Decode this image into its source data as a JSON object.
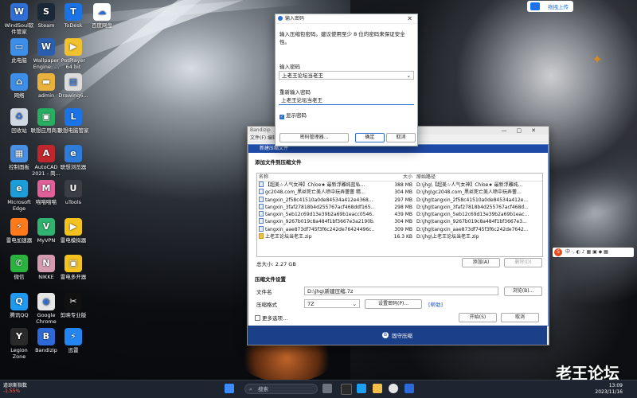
{
  "desktop_icons": [
    {
      "label": "WindSoul软件管家",
      "icon": "windsoul-icon",
      "color": "#2f6fd6",
      "glyph": "W"
    },
    {
      "label": "Steam",
      "icon": "steam-icon",
      "color": "#1b2838",
      "glyph": "S"
    },
    {
      "label": "ToDesk",
      "icon": "todesk-icon",
      "color": "#1a74e8",
      "glyph": "T"
    },
    {
      "label": "百度网盘",
      "icon": "baidu-netdisk-icon",
      "color": "#ffffff",
      "glyph": "☁"
    },
    {
      "label": "此电脑",
      "icon": "computer-icon",
      "color": "#3d8ee8",
      "glyph": "▭"
    },
    {
      "label": "Wallpaper Engine: ...",
      "icon": "wallpaper-engine-icon",
      "color": "#2a5fb0",
      "glyph": "W"
    },
    {
      "label": "PotPlayer 64 bit",
      "icon": "potplayer-icon",
      "color": "#f2c12e",
      "glyph": "▶"
    },
    {
      "label": "网络",
      "icon": "network-icon",
      "color": "#3d8ee8",
      "glyph": "⌂"
    },
    {
      "label": "admin",
      "icon": "user-folder-icon",
      "color": "#e9b23c",
      "glyph": "▬"
    },
    {
      "label": "Drawing6...",
      "icon": "drawing-file-icon",
      "color": "#dcdcdc",
      "glyph": "▤"
    },
    {
      "label": "回收站",
      "icon": "recycle-bin-icon",
      "color": "#cfd8e3",
      "glyph": "♻"
    },
    {
      "label": "联想应用商店",
      "icon": "lenovo-store-icon",
      "color": "#27ae60",
      "glyph": "▣"
    },
    {
      "label": "联想电脑管家",
      "icon": "lenovo-manager-icon",
      "color": "#1a74e8",
      "glyph": "L"
    },
    {
      "label": "控制面板",
      "icon": "control-panel-icon",
      "color": "#4a90e2",
      "glyph": "▦"
    },
    {
      "label": "AutoCAD 2021 - 简...",
      "icon": "autocad-icon",
      "color": "#c0262d",
      "glyph": "A"
    },
    {
      "label": "联想浏览器",
      "icon": "lenovo-browser-icon",
      "color": "#2e7bd9",
      "glyph": "e"
    },
    {
      "label": "Microsoft Edge",
      "icon": "edge-icon",
      "color": "#1c9dd8",
      "glyph": "e"
    },
    {
      "label": "喵喵喵喵",
      "icon": "meow-app-icon",
      "color": "#e0609a",
      "glyph": "M"
    },
    {
      "label": "uTools",
      "icon": "utools-icon",
      "color": "#3b3f45",
      "glyph": "U"
    },
    {
      "label": "雷电加速器",
      "icon": "leidian-accelerator-icon",
      "color": "#ff7a1a",
      "glyph": "⚡"
    },
    {
      "label": "MyVPN",
      "icon": "myvpn-icon",
      "color": "#2fb36e",
      "glyph": "V"
    },
    {
      "label": "雷电模拟器",
      "icon": "leidian-emulator-icon",
      "color": "#f4c21f",
      "glyph": "▶"
    },
    {
      "label": "微信",
      "icon": "wechat-icon",
      "color": "#29b33f",
      "glyph": "✆"
    },
    {
      "label": "NIKKE",
      "icon": "nikke-icon",
      "color": "#d49bb0",
      "glyph": "N"
    },
    {
      "label": "雷电多开器",
      "icon": "leidian-multi-icon",
      "color": "#f4c21f",
      "glyph": "▣"
    },
    {
      "label": "腾讯QQ",
      "icon": "qq-icon",
      "color": "#1e9bf0",
      "glyph": "Q"
    },
    {
      "label": "Google Chrome",
      "icon": "chrome-icon",
      "color": "#e6e6e6",
      "glyph": "◉"
    },
    {
      "label": "剪映专业版",
      "icon": "capcut-icon",
      "color": "#111111",
      "glyph": "✂"
    },
    {
      "label": "Legion Zone",
      "icon": "legion-zone-icon",
      "color": "#2a2a2a",
      "glyph": "Y"
    },
    {
      "label": "Bandizip",
      "icon": "bandizip-icon",
      "color": "#2d6ad8",
      "glyph": "B"
    },
    {
      "label": "迅雷",
      "icon": "thunder-icon",
      "color": "#2386f0",
      "glyph": "⚡"
    }
  ],
  "top_right": {
    "upload_label": "拖拽上传"
  },
  "bandizip": {
    "window_title": "Bandizip",
    "menu": "文件(F)  编辑",
    "dialog_title": "新建压缩文件",
    "add_section": "添加文件到压缩文件",
    "columns": {
      "name": "名称",
      "size": "大小",
      "path": "原始路径"
    },
    "files": [
      {
        "name": "【超美☆人气女神】Chloe★ 最新浮雕纯蓝私...",
        "size": "388 MB",
        "path": "D:\\jhg\\【超美☆人气女神】Chloe★ 最新浮雕纯...",
        "folder": false
      },
      {
        "name": "gc2048.com_黑丝死亡美人喷中玩弄蕾蕾 精...",
        "size": "304 MB",
        "path": "D:\\jhg\\gc2048.com_黑丝死亡美人喷中玩弄蕾...",
        "folder": false
      },
      {
        "name": "tangxin_2f58c41510a0de84534a412e4368...",
        "size": "297 MB",
        "path": "D:\\jhg\\tangxin_2f58c41510a0de84534a412e...",
        "folder": false
      },
      {
        "name": "tangxin_3faf27818b4d255767acf468ddf165...",
        "size": "298 MB",
        "path": "D:\\jhg\\tangxin_3faf27818b4d255767acf468d...",
        "folder": false
      },
      {
        "name": "tangxin_5eb12c69d13e39b2a69b1eacc0546...",
        "size": "439 MB",
        "path": "D:\\jhg\\tangxin_5eb12c69d13e39b2a69b1eac...",
        "folder": false
      },
      {
        "name": "tangxin_9267b019c8a484f1bf3667e3a2190b...",
        "size": "304 MB",
        "path": "D:\\jhg\\tangxin_9267b019c8a484f1bf3667e3...",
        "folder": false
      },
      {
        "name": "tangxin_aae873df745f3f6c242de76424496c...",
        "size": "309 MB",
        "path": "D:\\jhg\\tangxin_aae873df745f3f6c242de7642...",
        "folder": false
      },
      {
        "name": "上老王论坛当老王.zip",
        "size": "16.3 KB",
        "path": "D:\\jhg\\上老王论坛当老王.zip",
        "folder": true
      }
    ],
    "total": "总大小: 2.27 GB",
    "add_btn": "添加(A)",
    "delete_btn": "删除(D)",
    "settings_section": "压缩文件设置",
    "filename_label": "文件名",
    "filename_value": "D:\\jhg\\新建压缩.7z",
    "browse_btn": "浏览(B)...",
    "format_label": "压缩格式",
    "format_value": "7Z",
    "set_password_btn": "设置密码(P)...",
    "help_link": "[帮助]",
    "more_options": "更多选项...",
    "start_btn": "开始(S)",
    "cancel_btn": "取消",
    "footer_label": "固守压缩"
  },
  "password_dialog": {
    "title": "输入密码",
    "hint": "输入压缩包密码。建议使用至少 8 位的密码来保证安全性。",
    "password_label": "输入密码",
    "password_value": "上老王论坛当老王",
    "confirm_label": "重新输入密码",
    "confirm_value": "上老王论坛当老王",
    "show_password": "显示密码",
    "manager_btn": "密码管理器...",
    "ok_btn": "确定",
    "cancel_btn": "取消"
  },
  "ime_bar": {
    "label": "中 ·,   ◐  ♪  ▦  ▣  ◆  ▦"
  },
  "taskbar": {
    "weather_title": "道琼斯指数",
    "weather_value": "-1.55%",
    "search_placeholder": "搜索",
    "time": "13:09",
    "date": "2023/11/16"
  },
  "watermark": "老王论坛"
}
